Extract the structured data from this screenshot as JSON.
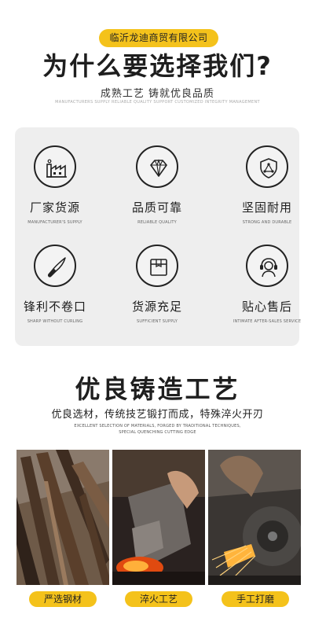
{
  "header": {
    "company_name": "临沂龙迪商贸有限公司",
    "title": "为什么要选择我们?",
    "subtitle": "成熟工艺 铸就优良品质",
    "subtitle_en": "MANUFACTURERS SUPPLY RELIABLE QUALITY SUPPORT CUSTOMIZED INTEGRITY MANAGEMENT"
  },
  "features": [
    {
      "icon": "factory-icon",
      "title": "厂家货源",
      "en": "MANUFACTURER'S SUPPLY"
    },
    {
      "icon": "diamond-icon",
      "title": "品质可靠",
      "en": "RELIABLE QUALITY"
    },
    {
      "icon": "shield-icon",
      "title": "坚固耐用",
      "en": "STRONG AND DURABLE"
    },
    {
      "icon": "knife-icon",
      "title": "锋利不卷口",
      "en": "SHARP WITHOUT CURLING"
    },
    {
      "icon": "box-icon",
      "title": "货源充足",
      "en": "SUFFICIENT SUPPLY"
    },
    {
      "icon": "headset-icon",
      "title": "贴心售后",
      "en": "INTIMATE AFTER-SALES SERVICE"
    }
  ],
  "process": {
    "title": "优良铸造工艺",
    "subtitle": "优良选材，传统技艺锻打而成，特殊淬火开刃",
    "subtitle_en_line1": "EXCELLENT SELECTION OF MATERIALS, FORGED BY TRADITIONAL TECHNIQUES,",
    "subtitle_en_line2": "SPECIAL QUENCHING CUTTING EDGE",
    "steps": [
      {
        "label": "严选钢材"
      },
      {
        "label": "淬火工艺"
      },
      {
        "label": "手工打磨"
      }
    ]
  },
  "colors": {
    "accent": "#f4c21b",
    "card_bg": "#eeeeee",
    "text": "#1e1e1e"
  }
}
